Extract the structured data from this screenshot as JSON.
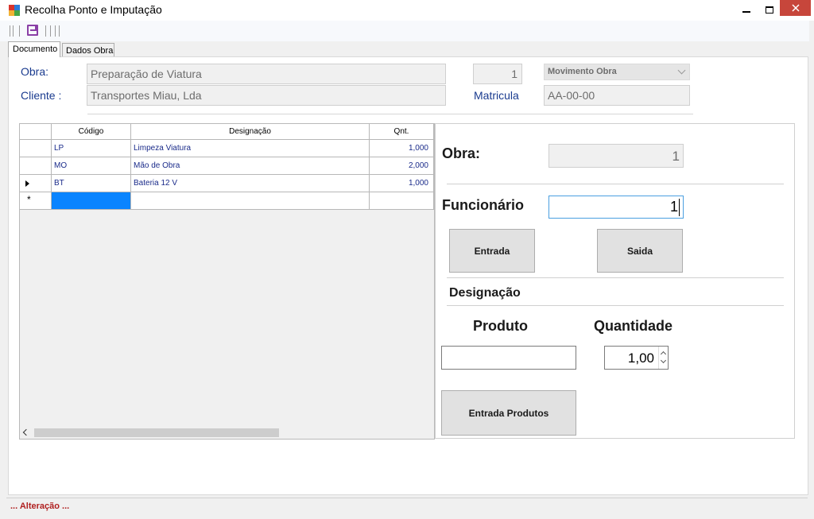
{
  "window": {
    "title": "Recolha Ponto e Imputação",
    "icon": "app-window-icon"
  },
  "toolbar": {
    "save_icon": "save-icon"
  },
  "tabs": [
    {
      "label": "Documento",
      "active": true
    },
    {
      "label": "Dados Obra",
      "active": false
    }
  ],
  "header": {
    "obra_label": "Obra:",
    "obra_value": "Preparação de Viatura",
    "cliente_label": "Cliente :",
    "cliente_value": "Transportes Miau, Lda",
    "number_value": "1",
    "movimento_value": "Movimento Obra",
    "matricula_label": "Matricula",
    "matricula_value": "AA-00-00"
  },
  "grid": {
    "columns": [
      "Código",
      "Designação",
      "Qnt."
    ],
    "rows": [
      {
        "codigo": "LP",
        "designacao": "Limpeza Viatura",
        "qnt": "1,000"
      },
      {
        "codigo": "MO",
        "designacao": "Mão de Obra",
        "qnt": "2,000"
      },
      {
        "codigo": "BT",
        "designacao": "Bateria 12 V",
        "qnt": "1,000"
      }
    ],
    "new_row_marker": "*"
  },
  "right_panel": {
    "obra_label": "Obra:",
    "obra_value": "1",
    "funcionario_label": "Funcionário",
    "funcionario_value": "1",
    "entrada_button": "Entrada",
    "saida_button": "Saida",
    "designacao_label": "Designação",
    "produto_label": "Produto",
    "produto_value": "",
    "quantidade_label": "Quantidade",
    "quantidade_value": "1,00",
    "entrada_produtos_button": "Entrada Produtos"
  },
  "status": {
    "text": "... Alteração ..."
  },
  "colors": {
    "label_blue": "#1a3b8f",
    "selection": "#0a84ff",
    "status_red": "#b02020",
    "close_red": "#c7463b"
  }
}
